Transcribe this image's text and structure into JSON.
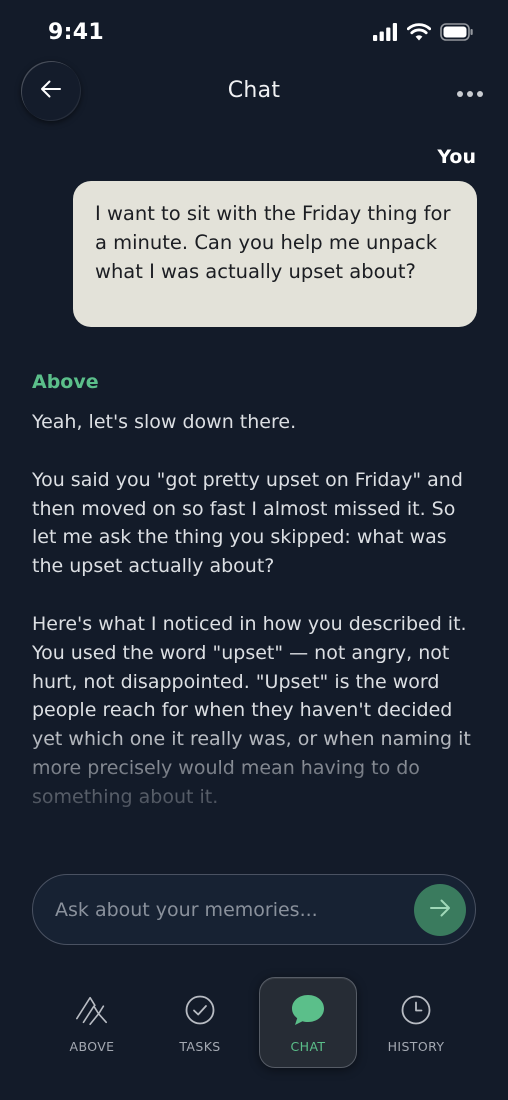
{
  "status_bar": {
    "time": "9:41"
  },
  "header": {
    "title": "Chat",
    "back_icon": "arrow-left-icon",
    "more_icon": "more-dots-icon"
  },
  "chat": {
    "user_label": "You",
    "user_message": "I want to sit with the Friday thing for a minute. Can you help me unpack what I was actually upset about?",
    "ai_label": "Above",
    "ai_paragraphs": [
      "Yeah, let's slow down there.",
      "You said you \"got pretty upset on Friday\" and then moved on so fast I almost missed it. So let me ask the thing you skipped: what was the upset actually about?",
      "Here's what I noticed in how you described it. You used the word \"upset\" — not angry, not hurt, not disappointed. \"Upset\" is the word people reach for when they haven't decided yet which one it really was, or when naming it more precisely would mean having to do something about it."
    ]
  },
  "input": {
    "placeholder": "Ask about your memories...",
    "value": "",
    "send_icon": "arrow-right-icon"
  },
  "tabs": [
    {
      "label": "ABOVE",
      "icon": "above-logo-icon",
      "active": false
    },
    {
      "label": "TASKS",
      "icon": "check-circle-icon",
      "active": false
    },
    {
      "label": "CHAT",
      "icon": "chat-bubble-icon",
      "active": true
    },
    {
      "label": "HISTORY",
      "icon": "clock-icon",
      "active": false
    }
  ],
  "colors": {
    "background": "#131b29",
    "accent_green": "#5bbf8a",
    "user_bubble": "#e3e2d9",
    "send_button": "#3a7b5e"
  }
}
